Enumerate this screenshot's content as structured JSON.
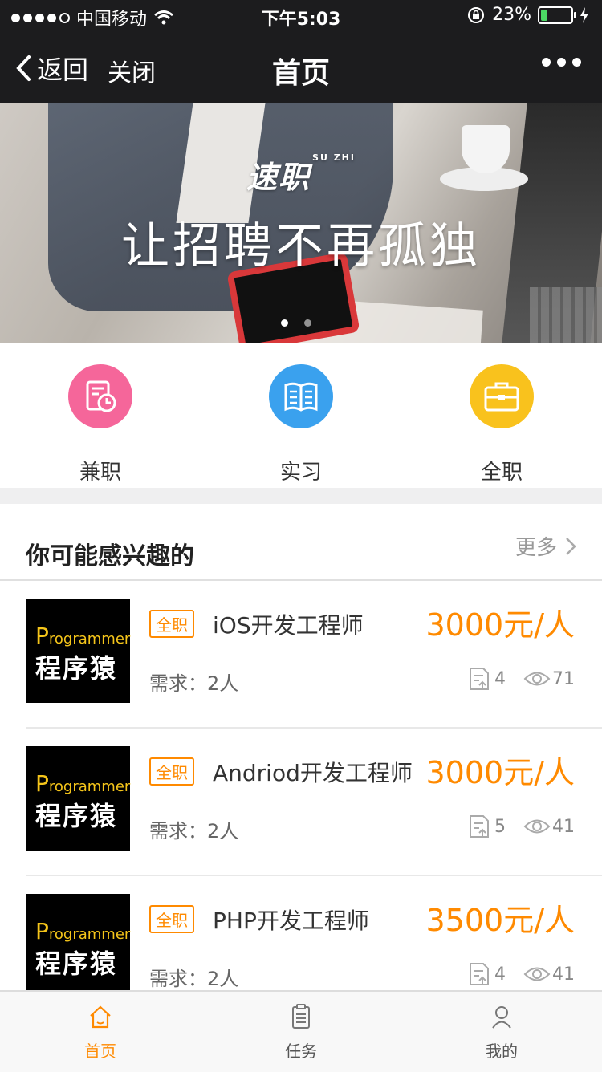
{
  "status_bar": {
    "carrier": "中国移动",
    "time": "下午5:03",
    "battery": "23%",
    "battery_level": 0.23
  },
  "nav": {
    "back": "返回",
    "close": "关闭",
    "title": "首页"
  },
  "banner": {
    "logo": "速职",
    "logo_small": "SU ZHI",
    "slogan": "让招聘不再孤独",
    "active_slide": 1,
    "slide_count": 2
  },
  "categories": [
    {
      "label": "兼职",
      "icon": "document-clock-icon",
      "color": "#f5669a"
    },
    {
      "label": "实习",
      "icon": "book-icon",
      "color": "#3aa1ee"
    },
    {
      "label": "全职",
      "icon": "briefcase-icon",
      "color": "#f9c21d"
    }
  ],
  "section": {
    "title": "你可能感兴趣的",
    "more": "更多"
  },
  "thumb": {
    "word": "rogrammer",
    "initial": "P",
    "cn": "程序猿"
  },
  "jobs": [
    {
      "tag": "全职",
      "title": "iOS开发工程师",
      "price": "3000元/人",
      "requirement": "需求：2人",
      "applications": "4",
      "views": "71"
    },
    {
      "tag": "全职",
      "title": "Andriod开发工程师",
      "price": "3000元/人",
      "requirement": "需求：2人",
      "applications": "5",
      "views": "41"
    },
    {
      "tag": "全职",
      "title": "PHP开发工程师",
      "price": "3500元/人",
      "requirement": "需求：2人",
      "applications": "4",
      "views": "41"
    }
  ],
  "tabs": [
    {
      "label": "首页",
      "icon": "home-icon",
      "active": true
    },
    {
      "label": "任务",
      "icon": "clipboard-icon",
      "active": false
    },
    {
      "label": "我的",
      "icon": "user-icon",
      "active": false
    }
  ],
  "colors": {
    "accent": "#ff8a00",
    "nav_bg": "#1c1c1e"
  }
}
